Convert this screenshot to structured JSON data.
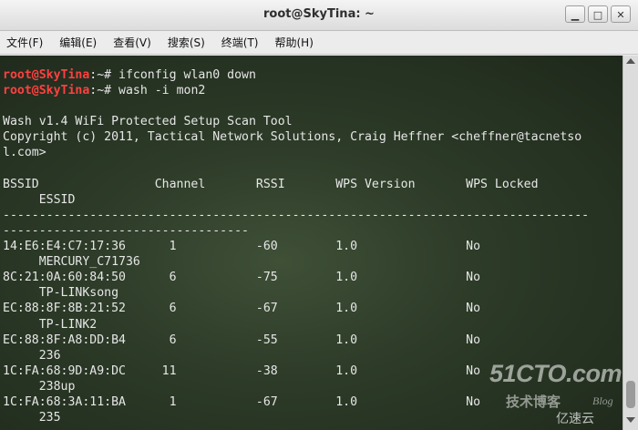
{
  "window": {
    "title": "root@SkyTina: ~",
    "minimize_glyph": "▁",
    "maximize_glyph": "□",
    "close_glyph": "✕"
  },
  "menubar": {
    "items": [
      "文件(F)",
      "编辑(E)",
      "查看(V)",
      "搜索(S)",
      "终端(T)",
      "帮助(H)"
    ]
  },
  "terminal": {
    "prompt_user": "root@SkyTina",
    "prompt_suffix": ":~# ",
    "cmd1": "ifconfig wlan0 down",
    "cmd2": "wash -i mon2",
    "banner1": "Wash v1.4 WiFi Protected Setup Scan Tool",
    "banner2": "Copyright (c) 2011, Tactical Network Solutions, Craig Heffner <cheffner@tacnetso",
    "banner3": "l.com>",
    "header1": "BSSID                Channel       RSSI       WPS Version       WPS Locked",
    "header2": "     ESSID",
    "divider1": "---------------------------------------------------------------------------------",
    "divider2": "----------------------------------",
    "rows": [
      {
        "line": "14:E6:E4:C7:17:36      1           -60        1.0               No",
        "essid": "     MERCURY_C71736"
      },
      {
        "line": "8C:21:0A:60:84:50      6           -75        1.0               No",
        "essid": "     TP-LINKsong"
      },
      {
        "line": "EC:88:8F:8B:21:52      6           -67        1.0               No",
        "essid": "     TP-LINK2"
      },
      {
        "line": "EC:88:8F:A8:DD:B4      6           -55        1.0               No",
        "essid": "     236"
      },
      {
        "line": "1C:FA:68:9D:A9:DC     11           -38        1.0               No",
        "essid": "     238up"
      },
      {
        "line": "1C:FA:68:3A:11:BA      1           -67        1.0               No",
        "essid": "     235"
      }
    ]
  },
  "watermark": {
    "site": "51CTO.com",
    "tagline": "技术博客",
    "blog": "Blog",
    "brand": "亿速云"
  }
}
